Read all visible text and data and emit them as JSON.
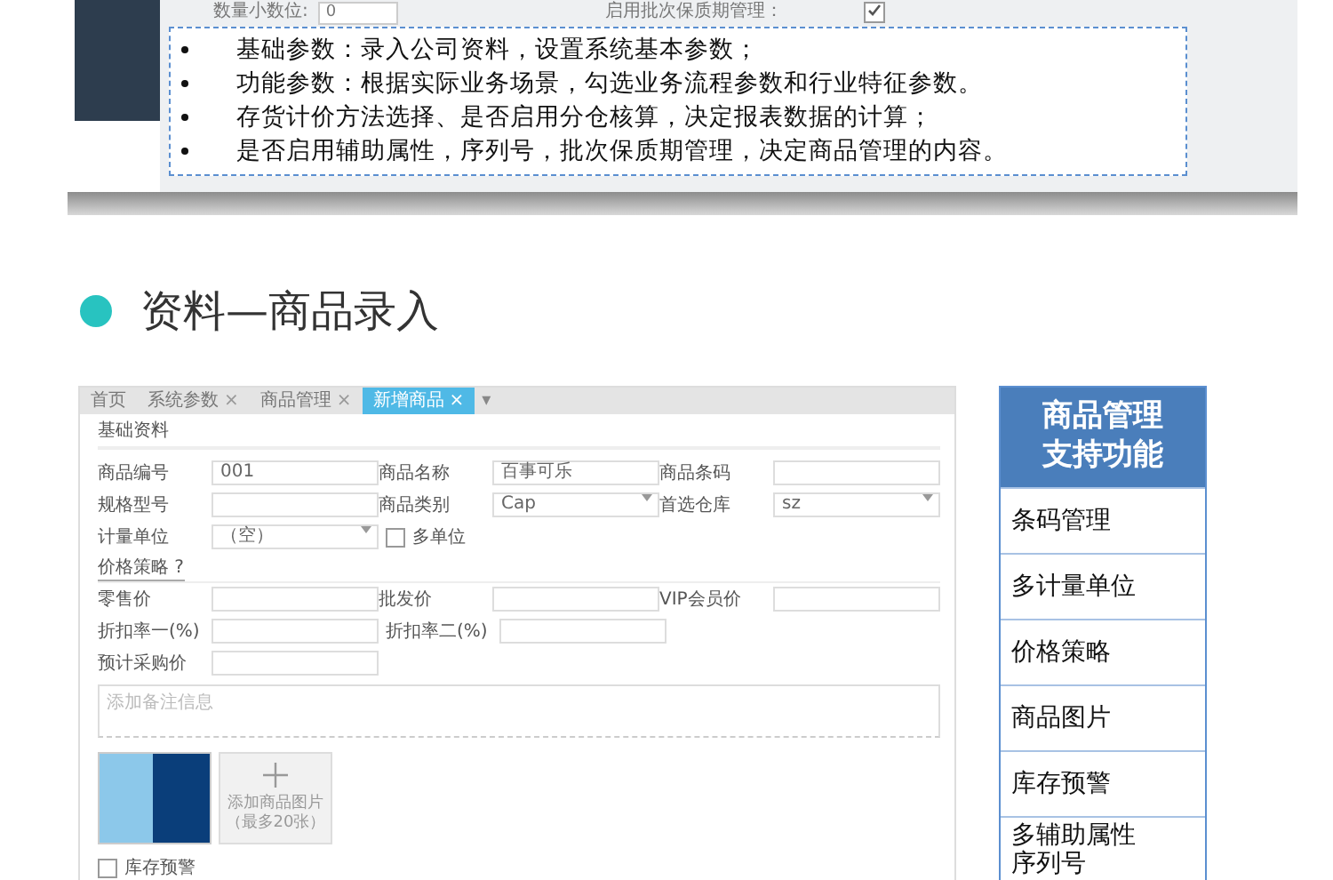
{
  "top_screenshot": {
    "field_label": "数量小数位:",
    "field_value": "0",
    "option_label": "启用批次保质期管理：",
    "option_checked": true
  },
  "notes": [
    "基础参数：录入公司资料，设置系统基本参数；",
    "功能参数：根据实际业务场景，勾选业务流程参数和行业特征参数。",
    "存货计价方法选择、是否启用分仓核算，决定报表数据的计算；",
    "是否启用辅助属性，序列号，批次保质期管理，决定商品管理的内容。"
  ],
  "section_title": "资料—商品录入",
  "app": {
    "tabs": [
      {
        "label": "首页",
        "selected": false
      },
      {
        "label": "系统参数",
        "close": "×",
        "selected": false
      },
      {
        "label": "商品管理",
        "close": "×",
        "selected": false
      },
      {
        "label": "新增商品",
        "close": "×",
        "selected": true
      }
    ],
    "tab_menu": "▾",
    "group_title": "基础资料",
    "basic_rows": [
      [
        {
          "label": "商品编号",
          "kind": "text",
          "value": "001"
        },
        {
          "label": "商品名称",
          "kind": "text",
          "value": "百事可乐"
        },
        {
          "label": "商品条码",
          "kind": "text"
        }
      ],
      [
        {
          "label": "规格型号",
          "kind": "text"
        },
        {
          "label": "商品类别",
          "kind": "select",
          "value": "Cap"
        },
        {
          "label": "首选仓库",
          "kind": "select",
          "value": "sz"
        }
      ],
      [
        {
          "label": "计量单位",
          "kind": "select",
          "value": "（空）"
        },
        {
          "label": "多单位",
          "kind": "checkbox",
          "checked": false
        }
      ]
    ],
    "price_link": "价格策略 ?",
    "price_rows": [
      [
        {
          "label": "零售价",
          "kind": "text"
        },
        {
          "label": "批发价",
          "kind": "text"
        },
        {
          "label": "VIP会员价",
          "kind": "text"
        }
      ],
      [
        {
          "label": "折扣率一(%)",
          "kind": "text"
        },
        {
          "label": "折扣率二(%)",
          "kind": "text"
        }
      ],
      [
        {
          "label": "预计采购价",
          "kind": "text"
        }
      ]
    ],
    "remark_placeholder": "添加备注信息",
    "add_image": {
      "title": "添加商品图片",
      "hint": "（最多20张）"
    },
    "stock_alert": {
      "label": "库存预警",
      "checked": false
    }
  },
  "features": {
    "title": "商品管理支持功能",
    "items": [
      "条码管理",
      "多计量单位",
      "价格策略",
      "商品图片",
      "库存预警",
      "多辅助属性序列号"
    ]
  }
}
